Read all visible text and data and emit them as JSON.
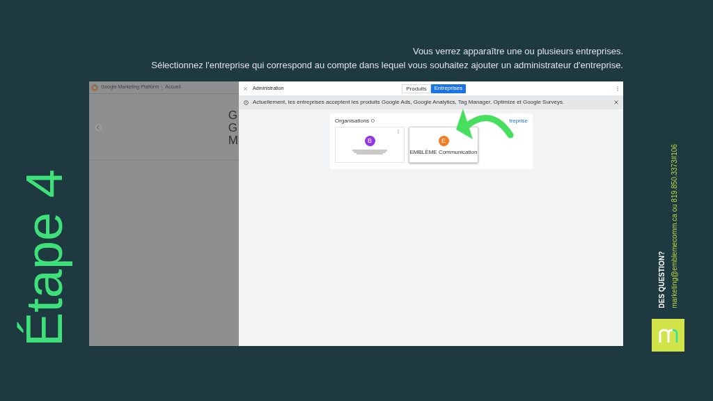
{
  "instructions": [
    "Vous verrez apparaître une ou plusieurs entreprises.",
    "Sélectionnez l'entreprise qui correspond au compte dans lequel vous souhaitez ajouter un administrateur d'entreprise."
  ],
  "step_label": "Étape 4",
  "contact": {
    "heading": "DES QUESTION?",
    "details": "marketing@emblemecomm.ca ou 819.850.3373#106"
  },
  "screenshot": {
    "background_page": {
      "brand": "Google Marketing Platform",
      "breadcrumb": "Accueil",
      "headline_fragments": [
        "G",
        "G",
        "M"
      ]
    },
    "panel": {
      "title": "Administration",
      "tabs": [
        {
          "label": "Produits",
          "selected": false
        },
        {
          "label": "Entreprises",
          "selected": true
        }
      ],
      "notice": "Actuellement, les entreprises acceptent les produits Google Ads, Google Analytics, Tag Manager, Optimize et Google Surveys.",
      "section_title": "Organisations",
      "link": "treprise",
      "organizations": [
        {
          "initial": "B",
          "color": "#9334e6",
          "redacted": true,
          "selected": false
        },
        {
          "initial": "E",
          "color": "#f57c20",
          "name": "EMBLÈME Communication",
          "redacted": false,
          "selected": true
        }
      ]
    }
  }
}
